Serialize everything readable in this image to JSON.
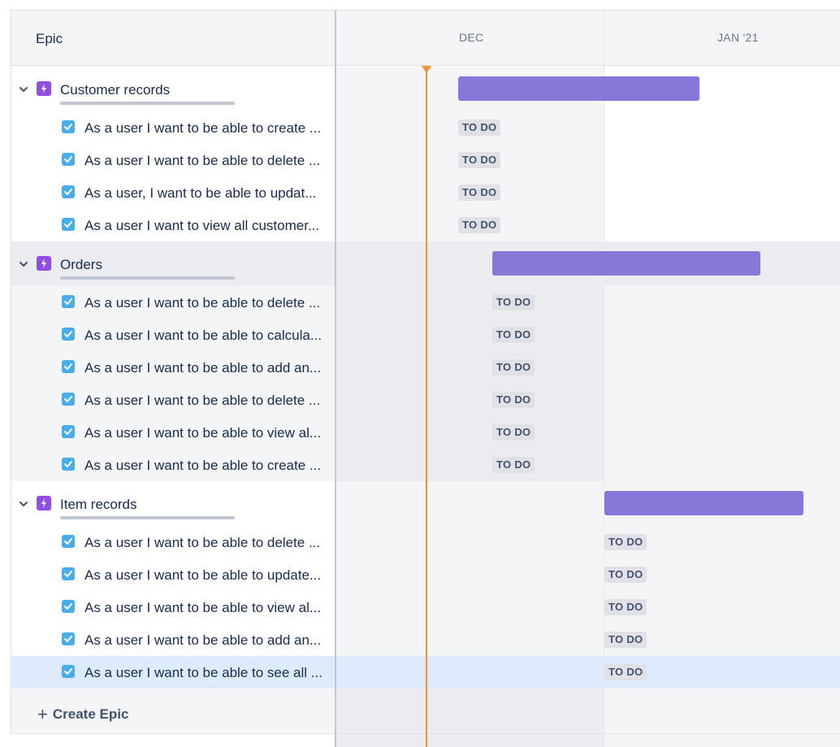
{
  "header": {
    "epic_label": "Epic",
    "months": [
      "DEC",
      "JAN '21"
    ]
  },
  "epics": [
    {
      "title": "Customer records",
      "stories": [
        {
          "title": "As a user I want to be able to create ...",
          "status": "TO DO"
        },
        {
          "title": "As a user I want to be able to delete ...",
          "status": "TO DO"
        },
        {
          "title": "As a user, I want to be able to updat...",
          "status": "TO DO"
        },
        {
          "title": "As a user I want to view all customer...",
          "status": "TO DO"
        }
      ]
    },
    {
      "title": "Orders",
      "stories": [
        {
          "title": "As a user I want to be able to delete ...",
          "status": "TO DO"
        },
        {
          "title": "As a user I want to be able to calcula...",
          "status": "TO DO"
        },
        {
          "title": "As a user I want to be able to add an...",
          "status": "TO DO"
        },
        {
          "title": "As a user I want to be able to delete ...",
          "status": "TO DO"
        },
        {
          "title": "As a user I want to be able to view al...",
          "status": "TO DO"
        },
        {
          "title": "As a user I want to be able to create ...",
          "status": "TO DO"
        }
      ]
    },
    {
      "title": "Item records",
      "stories": [
        {
          "title": "As a user I want to be able to delete ...",
          "status": "TO DO"
        },
        {
          "title": "As a user I want to be able to update...",
          "status": "TO DO"
        },
        {
          "title": "As a user I want to be able to view al...",
          "status": "TO DO"
        },
        {
          "title": "As a user I want to be able to add an...",
          "status": "TO DO"
        },
        {
          "title": "As a user I want to be able to see all ...",
          "status": "TO DO"
        }
      ]
    }
  ],
  "footer": {
    "create_epic_label": "Create Epic"
  },
  "colors": {
    "epic_bar": "#8777d9",
    "today_line": "#f79232",
    "epic_icon": "#904ee2",
    "story_icon": "#4bade8",
    "selected_row": "#deebff"
  }
}
